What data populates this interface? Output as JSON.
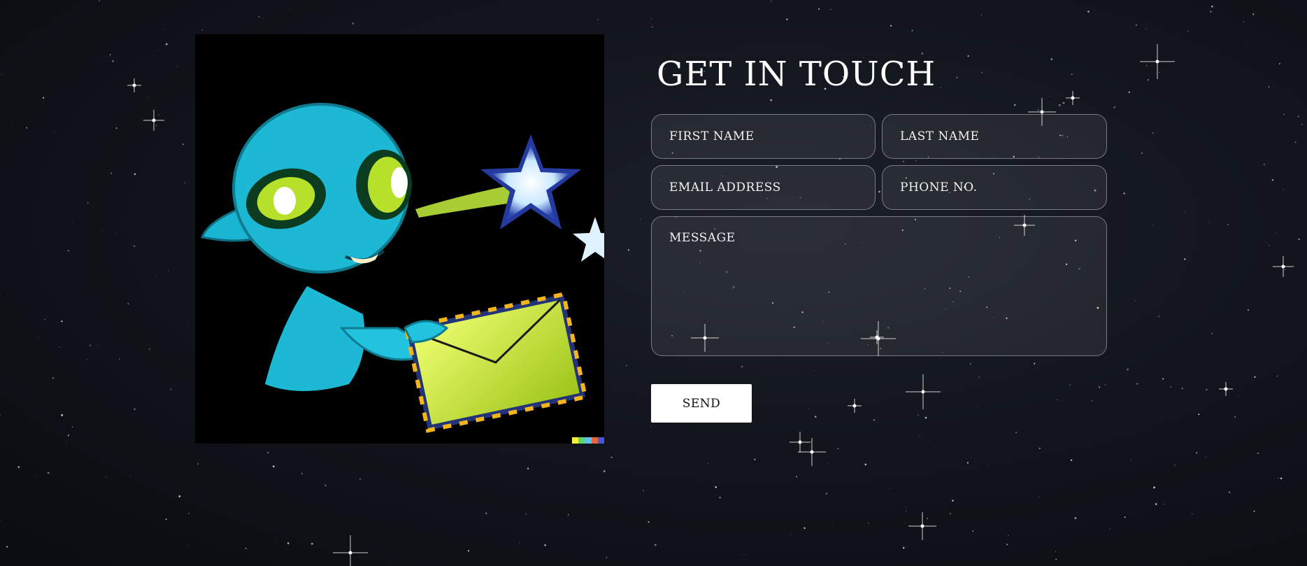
{
  "contact": {
    "title": "GET IN TOUCH",
    "first_name_placeholder": "FIRST NAME",
    "last_name_placeholder": "LAST NAME",
    "email_placeholder": "EMAIL ADDRESS",
    "phone_placeholder": "PHONE NO.",
    "message_placeholder": "MESSAGE",
    "send_label": "SEND"
  },
  "illustration": {
    "subject": "alien-holding-envelope-with-stars",
    "palette_colors": [
      "#f7f23a",
      "#5ad66a",
      "#59c3e8",
      "#e8663c",
      "#4a55d8"
    ]
  },
  "colors": {
    "background": "#12151c",
    "text": "#ffffff",
    "button_bg": "#ffffff",
    "button_text": "#111111",
    "field_border": "rgba(255,255,255,0.38)"
  }
}
